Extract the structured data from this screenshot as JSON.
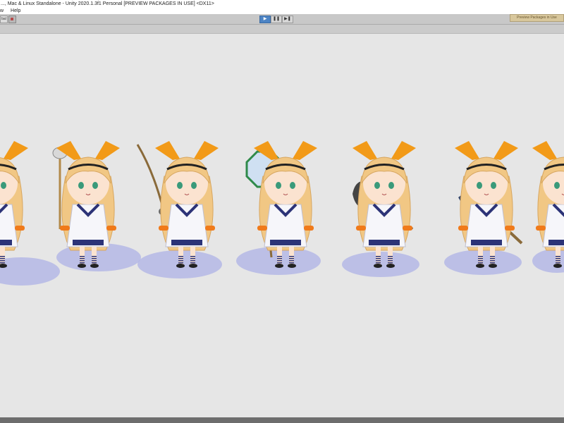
{
  "window": {
    "title": "..., Mac & Linux Standalone - Unity 2020.1.3f1 Personal [PREVIEW PACKAGES IN USE] <DX11>"
  },
  "menu": {
    "items": [
      {
        "label": "w"
      },
      {
        "label": "Help"
      }
    ]
  },
  "toolbar": {
    "pivot_label": "bal",
    "play_label": "▶",
    "pause_label": "❚❚",
    "step_label": "▶❚",
    "preview_packages_label": "Preview Packages in Use"
  },
  "scene": {
    "background": "#e6e6e6",
    "accent_hair": "#f1c784",
    "accent_ribbon": "#f29a18",
    "accent_uniform": "#2c3377",
    "accent_shadow": "#aeb2e5",
    "characters": [
      {
        "tool": "none"
      },
      {
        "tool": "mop"
      },
      {
        "tool": "fishing-rod"
      },
      {
        "tool": "net"
      },
      {
        "tool": "shovel"
      },
      {
        "tool": "axe"
      },
      {
        "tool": "none"
      }
    ]
  }
}
